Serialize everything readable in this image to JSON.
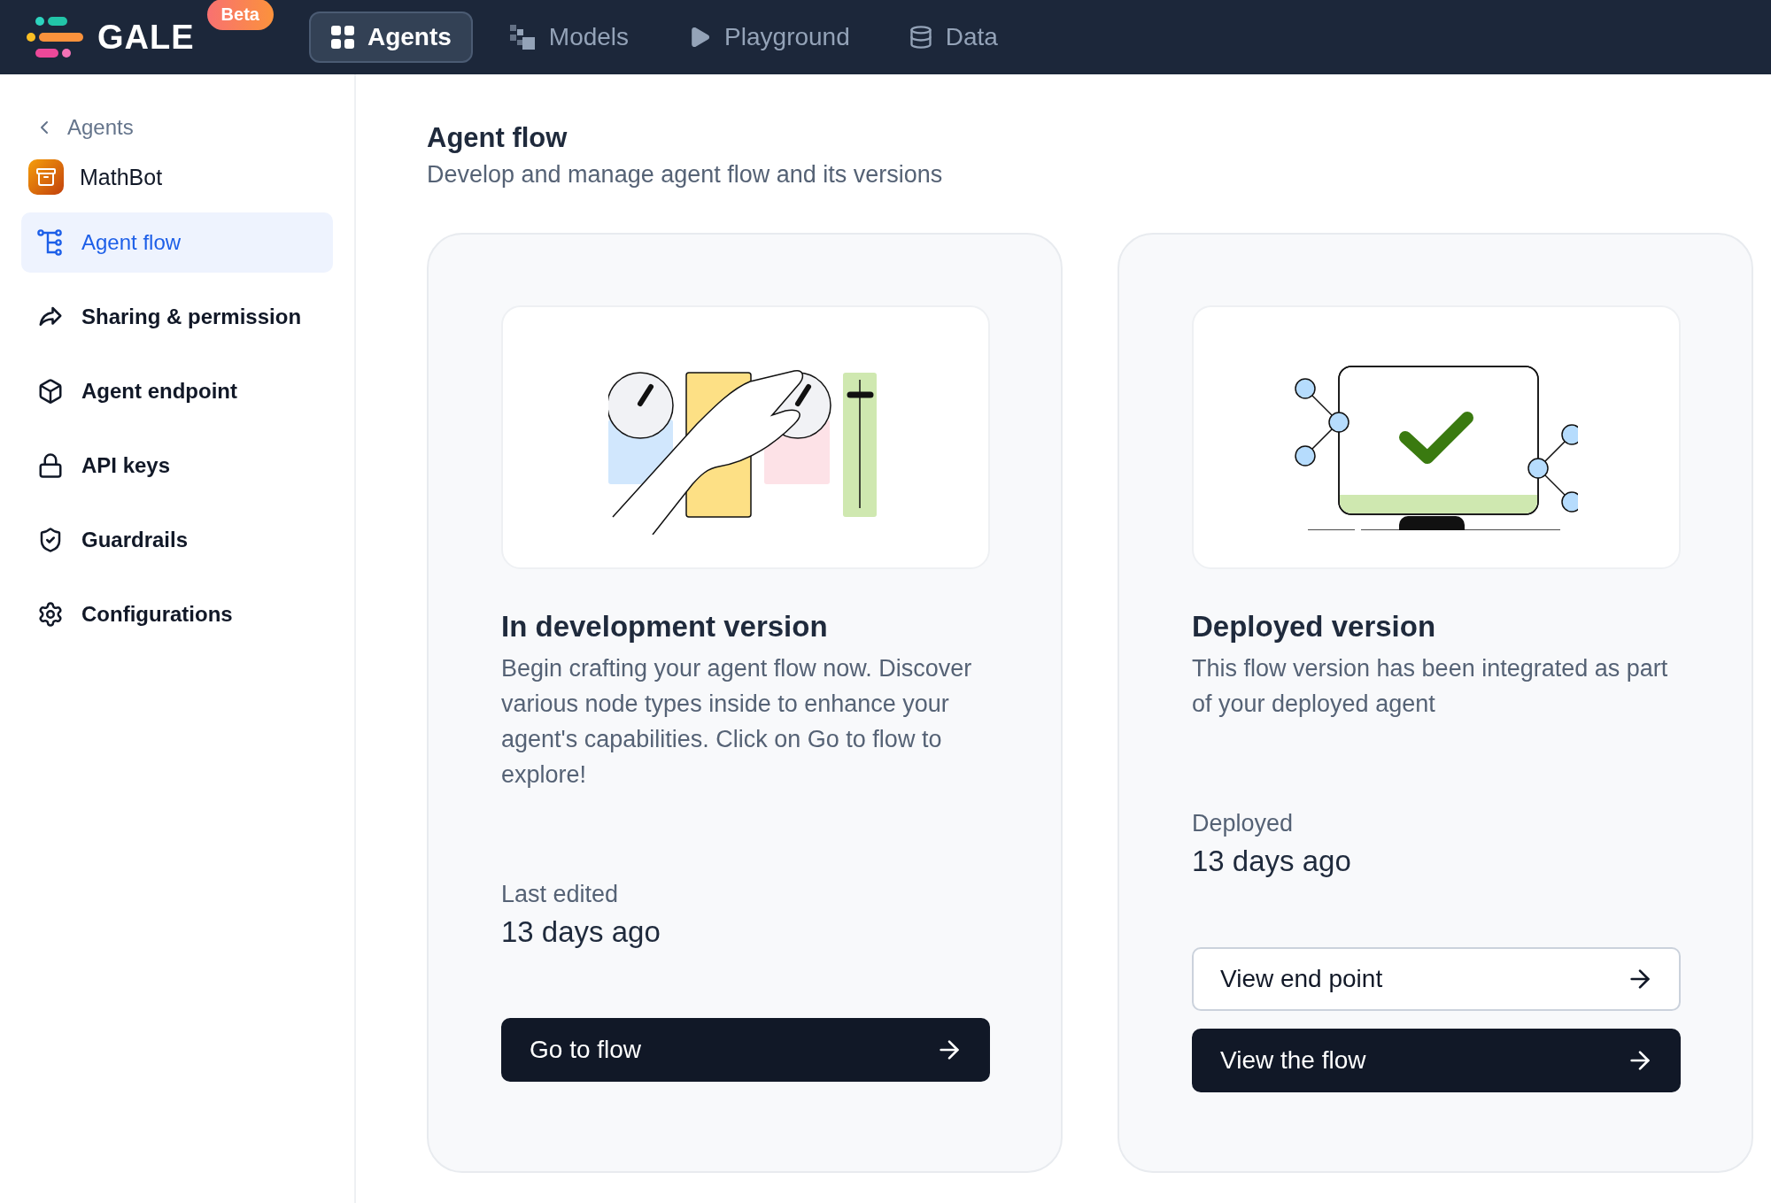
{
  "topbar": {
    "logo_text": "GALE",
    "badge": "Beta",
    "nav": [
      {
        "label": "Agents",
        "selected": true
      },
      {
        "label": "Models",
        "selected": false
      },
      {
        "label": "Playground",
        "selected": false
      },
      {
        "label": "Data",
        "selected": false
      }
    ]
  },
  "sidebar": {
    "back_link": "Agents",
    "agent_name": "MathBot",
    "items": [
      {
        "label": "Agent flow",
        "selected": true
      },
      {
        "label": "Sharing & permission",
        "selected": false
      },
      {
        "label": "Agent endpoint",
        "selected": false
      },
      {
        "label": "API keys",
        "selected": false
      },
      {
        "label": "Guardrails",
        "selected": false
      },
      {
        "label": "Configurations",
        "selected": false
      }
    ]
  },
  "page": {
    "title": "Agent flow",
    "subtitle": "Develop and manage agent flow and its versions"
  },
  "cards": [
    {
      "kind": "development",
      "title": "In development version",
      "description": "Begin crafting your agent flow now. Discover various node types inside to enhance your agent's capabilities. Click on Go to flow to explore!",
      "meta_label": "Last edited",
      "meta_value": "13 days ago",
      "buttons": [
        {
          "label": "Go to flow",
          "kind": "solid"
        }
      ]
    },
    {
      "kind": "deployed",
      "title": "Deployed version",
      "description": "This flow version has been integrated as part of your deployed agent",
      "meta_label": "Deployed",
      "meta_value": "13 days ago",
      "buttons": [
        {
          "label": "View end point",
          "kind": "outline"
        },
        {
          "label": "View the flow",
          "kind": "solid"
        }
      ]
    }
  ]
}
